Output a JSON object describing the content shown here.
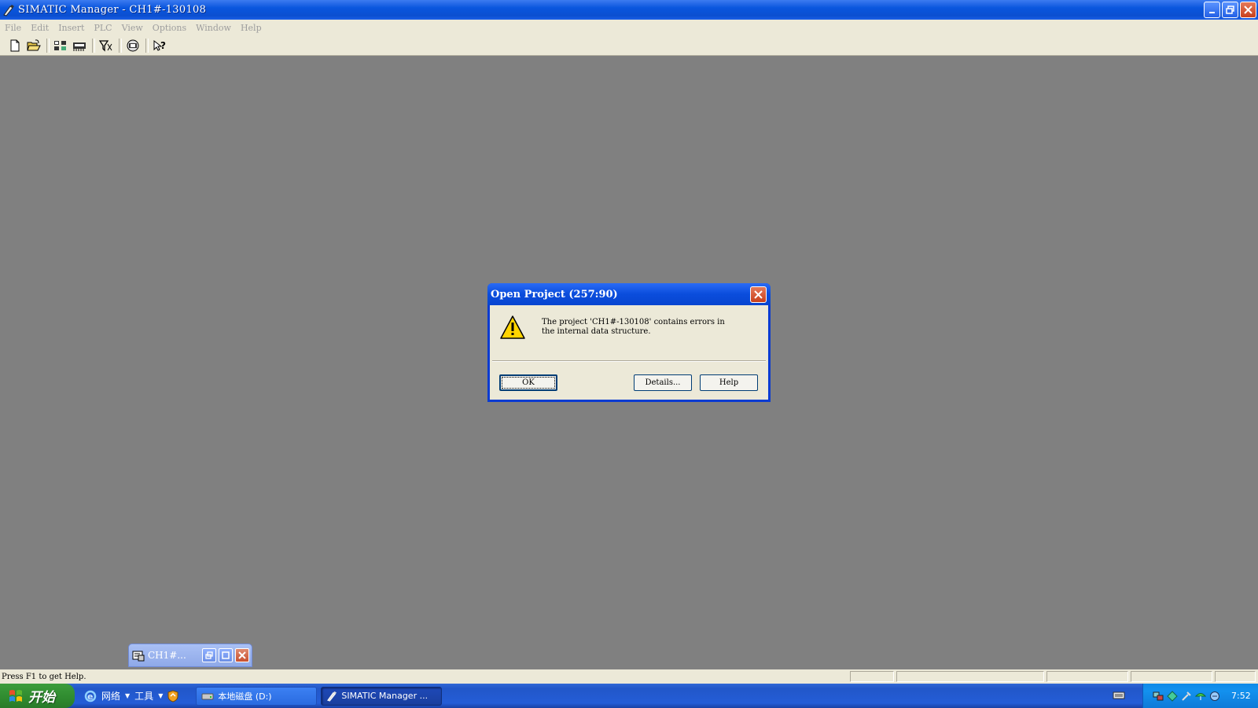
{
  "window": {
    "title": "SIMATIC Manager - CH1#-130108"
  },
  "menu": [
    "File",
    "Edit",
    "Insert",
    "PLC",
    "View",
    "Options",
    "Window",
    "Help"
  ],
  "toolbar": {
    "icons": [
      "new-icon",
      "open-icon",
      "accessible-nodes-icon",
      "memory-card-icon",
      "filter-icon",
      "simulation-icon",
      "context-help-icon"
    ]
  },
  "minimized_window": {
    "title": "CH1#..."
  },
  "dialog": {
    "title": "Open Project (257:90)",
    "message": "The project 'CH1#-130108' contains errors in\nthe internal data structure.",
    "ok_label": "OK",
    "details_label": "Details...",
    "help_label": "Help"
  },
  "statusbar": {
    "text": "Press F1 to get Help."
  },
  "taskbar": {
    "start_label": "开始",
    "quick_launch": [
      "网络",
      "工具"
    ],
    "tasks": [
      "本地磁盘 (D:)",
      "SIMATIC Manager ..."
    ],
    "clock": "7:52"
  },
  "colors": {
    "titlebar": "#0a56de",
    "desktop_bg": "#808080",
    "menu_bg": "#ece9d8",
    "taskbar": "#245dd7",
    "start_green": "#2f8a2f"
  }
}
